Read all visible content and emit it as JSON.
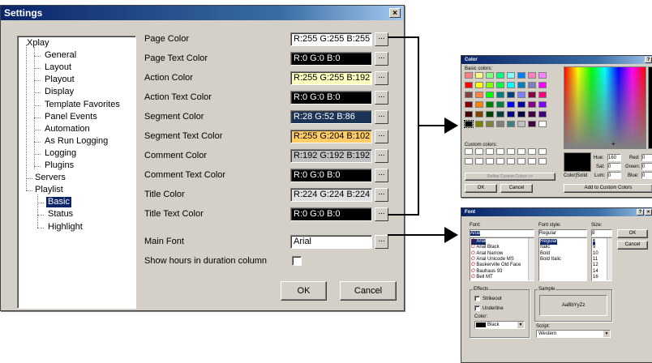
{
  "settings": {
    "title": "Settings",
    "close_glyph": "×",
    "tree": {
      "root": "Xplay",
      "items": [
        "General",
        "Layout",
        "Playout",
        "Display",
        "Template Favorites",
        "Panel Events",
        "Automation",
        "As Run Logging",
        "Logging",
        "Plugins"
      ],
      "servers": "Servers",
      "playlist": "Playlist",
      "playlist_items": [
        "Basic",
        "Status",
        "Highlight"
      ],
      "selected": "Basic"
    },
    "rows": [
      {
        "label": "Page Color",
        "value": "R:255 G:255 B:255",
        "bg": "#ffffff",
        "fg": "#000000"
      },
      {
        "label": "Page Text Color",
        "value": "R:0 G:0 B:0",
        "bg": "#000000",
        "fg": "#ffffff"
      },
      {
        "label": "Action Color",
        "value": "R:255 G:255 B:192",
        "bg": "#ffffc0",
        "fg": "#000000"
      },
      {
        "label": "Action Text Color",
        "value": "R:0 G:0 B:0",
        "bg": "#000000",
        "fg": "#ffffff"
      },
      {
        "label": "Segment Color",
        "value": "R:28 G:52 B:86",
        "bg": "#1c3456",
        "fg": "#ffffff"
      },
      {
        "label": "Segment Text Color",
        "value": "R:255 G:204 B:102",
        "bg": "#ffcc66",
        "fg": "#000000"
      },
      {
        "label": "Comment Color",
        "value": "R:192 G:192 B:192",
        "bg": "#c0c0c0",
        "fg": "#000000"
      },
      {
        "label": "Comment Text Color",
        "value": "R:0 G:0 B:0",
        "bg": "#000000",
        "fg": "#ffffff"
      },
      {
        "label": "Title Color",
        "value": "R:224 G:224 B:224",
        "bg": "#e0e0e0",
        "fg": "#000000"
      },
      {
        "label": "Title Text Color",
        "value": "R:0 G:0 B:0",
        "bg": "#000000",
        "fg": "#ffffff"
      }
    ],
    "main_font_label": "Main Font",
    "main_font_value": "Arial",
    "hours_label": "Show hours in duration column",
    "browse_label": "...",
    "ok_label": "OK",
    "cancel_label": "Cancel"
  },
  "color_dialog": {
    "title": "Color",
    "help_glyph": "?",
    "basic_colors_label": "Basic colors:",
    "basic_colors": [
      "#ff8080",
      "#ffff80",
      "#80ff80",
      "#00ff80",
      "#80ffff",
      "#0080ff",
      "#ff80c0",
      "#ff80ff",
      "#ff0000",
      "#ffff00",
      "#80ff00",
      "#00ff40",
      "#00ffff",
      "#0080c0",
      "#8080c0",
      "#ff00ff",
      "#804040",
      "#ff8040",
      "#00ff00",
      "#008080",
      "#004080",
      "#8080ff",
      "#800040",
      "#ff0080",
      "#800000",
      "#ff8000",
      "#008000",
      "#008040",
      "#0000ff",
      "#0000a0",
      "#800080",
      "#8000ff",
      "#400000",
      "#804000",
      "#004000",
      "#004040",
      "#000080",
      "#000040",
      "#400040",
      "#400080",
      "#000000",
      "#808000",
      "#808040",
      "#808080",
      "#408080",
      "#c0c0c0",
      "#400040",
      "#ffffff"
    ],
    "custom_colors_label": "Custom colors:",
    "define_custom_label": "Define Custom Colors >>",
    "ok_label": "OK",
    "cancel_label": "Cancel",
    "color_solid_label": "Color|Solid",
    "hue_label": "Hue:",
    "hue_value": "160",
    "sat_label": "Sat:",
    "sat_value": "0",
    "lum_label": "Lum:",
    "lum_value": "0",
    "red_label": "Red:",
    "red_value": "0",
    "green_label": "Green:",
    "green_value": "0",
    "blue_label": "Blue:",
    "blue_value": "0",
    "add_custom_label": "Add to Custom Colors"
  },
  "font_dialog": {
    "title": "Font",
    "help_glyph": "?",
    "close_glyph": "×",
    "font_label": "Font:",
    "font_value": "Arial",
    "fonts": [
      "Arial",
      "Arial Black",
      "Arial Narrow",
      "Arial Unicode MS",
      "Baskerville Old Face",
      "Bauhaus 93",
      "Bell MT"
    ],
    "style_label": "Font style:",
    "style_value": "Regular",
    "styles": [
      "Regular",
      "Italic",
      "Bold",
      "Bold Italic"
    ],
    "size_label": "Size:",
    "size_value": "8",
    "sizes": [
      "8",
      "9",
      "10",
      "11",
      "12",
      "14",
      "16"
    ],
    "ok_label": "OK",
    "cancel_label": "Cancel",
    "effects_label": "Effects",
    "strikeout_label": "Strikeout",
    "underline_label": "Underline",
    "color_label": "Color:",
    "color_value": "Black",
    "sample_label": "Sample",
    "sample_text": "AaBbYyZz",
    "script_label": "Script:",
    "script_value": "Western"
  }
}
